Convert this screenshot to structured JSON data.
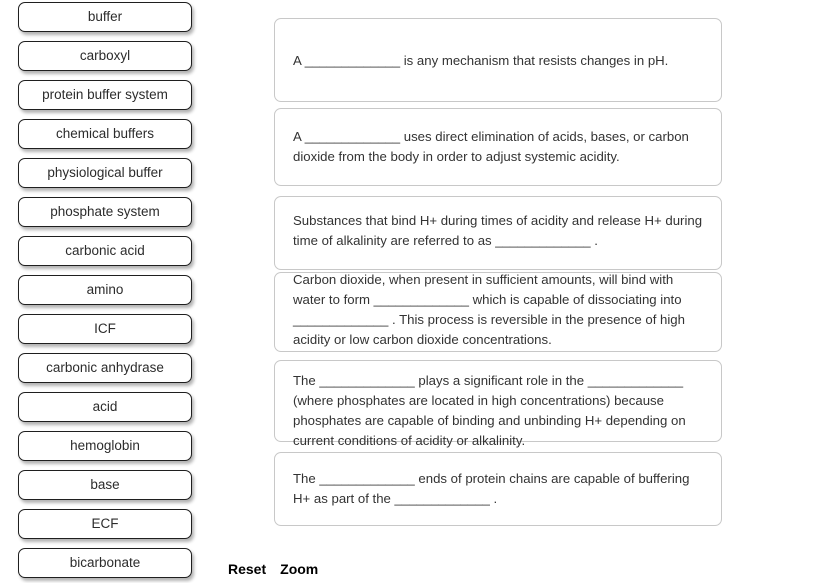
{
  "tray": {
    "tiles": [
      {
        "label": "buffer"
      },
      {
        "label": "carboxyl"
      },
      {
        "label": "protein buffer system"
      },
      {
        "label": "chemical buffers"
      },
      {
        "label": "physiological buffer"
      },
      {
        "label": "phosphate system"
      },
      {
        "label": "carbonic acid"
      },
      {
        "label": "amino"
      },
      {
        "label": "ICF"
      },
      {
        "label": "carbonic anhydrase"
      },
      {
        "label": "acid"
      },
      {
        "label": "hemoglobin"
      },
      {
        "label": "base"
      },
      {
        "label": "ECF"
      },
      {
        "label": "bicarbonate"
      }
    ]
  },
  "questions": [
    {
      "id": "q1",
      "text": "A _____________ is any mechanism that resists changes in pH."
    },
    {
      "id": "q2",
      "text": "A _____________ uses direct elimination of acids, bases, or carbon dioxide from the body in order to adjust systemic acidity."
    },
    {
      "id": "q3",
      "text": "Substances that bind H+ during times of acidity and release H+ during time of alkalinity are referred to as _____________ ."
    },
    {
      "id": "q4",
      "text": "Carbon dioxide, when present in sufficient amounts, will bind with water to form _____________ which is capable of dissociating into _____________ . This process is reversible in the presence of high acidity or low carbon dioxide concentrations."
    },
    {
      "id": "q5",
      "text": "The _____________ plays a significant role in the _____________ (where phosphates are located in high concentrations) because phosphates are capable of binding and unbinding H+ depending on current conditions of acidity or alkalinity."
    },
    {
      "id": "q6",
      "text": "The _____________ ends of protein chains are capable of buffering H+ as part of the _____________ ."
    }
  ],
  "controls": {
    "reset_label": "Reset",
    "zoom_label": "Zoom"
  },
  "colors": {
    "page_background": "#ffffff",
    "tile_border": "#1f1f1f",
    "tile_fill": "#ffffff",
    "card_border": "#c8c8c8",
    "text": "#333333",
    "control_text": "#000000"
  }
}
